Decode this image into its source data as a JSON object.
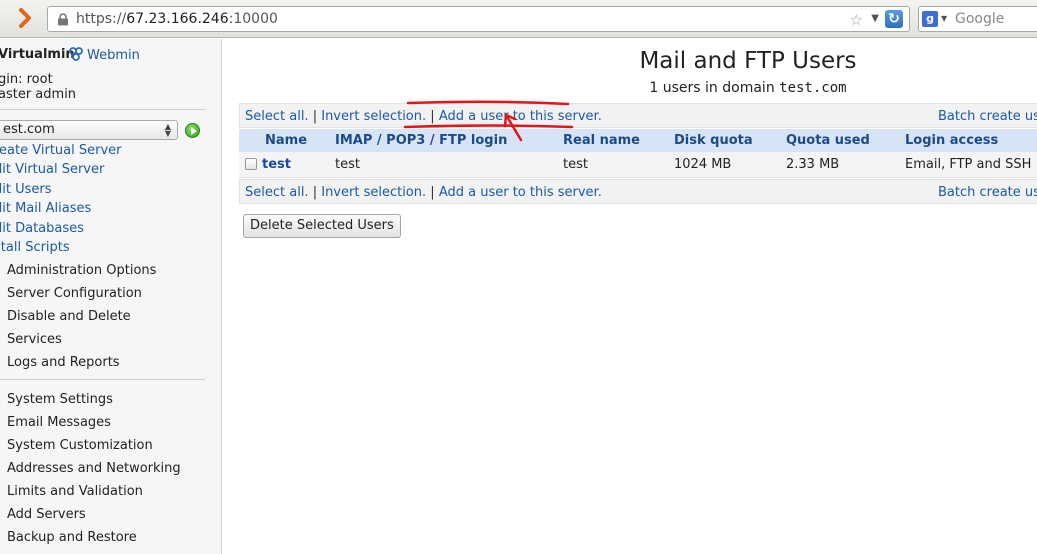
{
  "browser": {
    "url_scheme": "https://",
    "url_host": "67.23.166.246",
    "url_port": ":10000",
    "search_placeholder": "Google"
  },
  "sidebar": {
    "brand": "Virtualmin",
    "webmin_link": "Webmin",
    "login_line": "gin: root",
    "role_line": "aster admin",
    "domain_selected": "est.com",
    "nav_links": [
      "reate Virtual Server",
      "dit Virtual Server",
      "dit Users",
      "dit Mail Aliases",
      "dit Databases",
      "stall Scripts"
    ],
    "categories_1": [
      "Administration Options",
      "Server Configuration",
      "Disable and Delete",
      "Services",
      "Logs and Reports"
    ],
    "categories_2": [
      "System Settings",
      "Email Messages",
      "System Customization",
      "Addresses and Networking",
      "Limits and Validation",
      "Add Servers",
      "Backup and Restore"
    ]
  },
  "main": {
    "title": "Mail and FTP Users",
    "subtitle_prefix": "1 users in domain ",
    "subtitle_domain": "test.com",
    "links": {
      "select_all": "Select all.",
      "invert": "Invert selection.",
      "add_user": "Add a user to this server.",
      "batch": "Batch create use",
      "separator": "|"
    },
    "table": {
      "headers": [
        "Name",
        "IMAP / POP3 / FTP login",
        "Real name",
        "Disk quota",
        "Quota used",
        "Login access"
      ],
      "rows": [
        {
          "name": "test",
          "login": "test",
          "real_name": "test",
          "disk_quota": "1024 MB",
          "quota_used": "2.33 MB",
          "access": "Email, FTP and SSH"
        }
      ]
    },
    "delete_button": "Delete Selected Users"
  },
  "colors": {
    "link": "#1a5aa8",
    "header_bg": "#d7e4f5",
    "annotation": "#e0161c"
  }
}
